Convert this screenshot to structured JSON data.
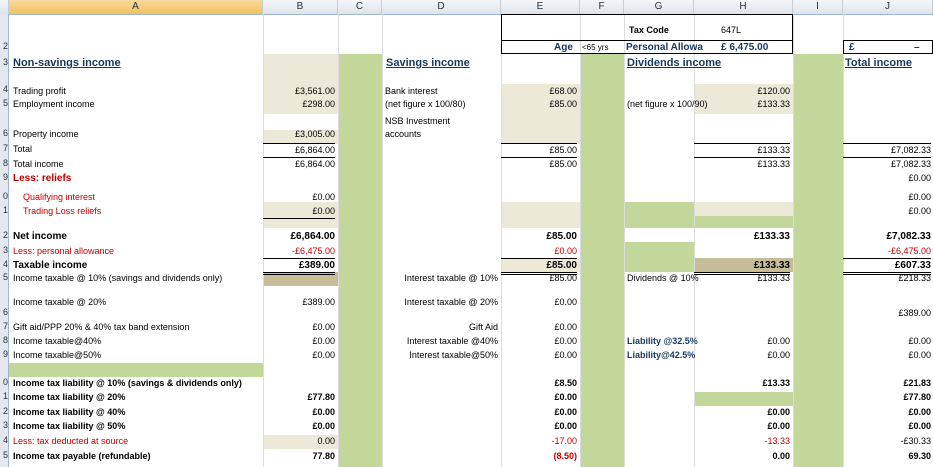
{
  "columns": [
    "A",
    "B",
    "C",
    "D",
    "E",
    "F",
    "G",
    "H",
    "I",
    "J"
  ],
  "row_numbers": [
    "",
    "2",
    "3",
    "4",
    "5",
    "",
    "6",
    "7",
    "8",
    "9",
    "0",
    "1",
    "",
    "2",
    "3",
    "4",
    "5",
    "",
    "6",
    "7",
    "8",
    "9",
    "",
    "0",
    "1",
    "2",
    "3",
    "4",
    "5"
  ],
  "header": {
    "tax_code_label": "Tax Code",
    "tax_code_value": "647L",
    "age_label": "Age",
    "age_value": "<65 yrs",
    "personal_allowance_label": "Personal Allowa",
    "personal_allowance_value": "£ 6,475.00",
    "j_currency": "£",
    "j_dash": "–"
  },
  "sections": {
    "non_savings": "Non-savings income",
    "savings": "Savings income",
    "dividends": "Dividends income",
    "total": "Total income"
  },
  "labels": {
    "trading_profit": "Trading profit",
    "employment_income": "Employment income",
    "bank_interest": "Bank interest",
    "net_figure_80": "(net figure x 100/80)",
    "net_figure_90": "(net figure x 100/90)",
    "nsb_1": "NSB Investment",
    "nsb_2": "accounts",
    "property_income": "Property income",
    "total": "Total",
    "total_income": "Total income",
    "less_reliefs": "Less: reliefs",
    "qualifying_interest": "Qualifying interest",
    "trading_loss": "Trading Loss reliefs",
    "net_income": "Net income",
    "less_pa": "Less: personal allowance",
    "taxable_income": "Taxable income",
    "income_taxable_10": "Income taxable @ 10% (savings and dividends only)",
    "interest_taxable_10": "Interest taxable @ 10%",
    "dividends_10": "Dividends @ 10%",
    "income_taxable_20": "Income taxable @ 20%",
    "interest_taxable_20": "Interest taxable @ 20%",
    "gift_aid_ext": "Gift aid/PPP 20% & 40% tax band extension",
    "gift_aid": "Gift Aid",
    "income_taxable_40": "Income taxable@40%",
    "interest_taxable_40": "Interest taxable @40%",
    "liability_325": "Liability @32.5%",
    "income_taxable_50": "Income taxable@50%",
    "interest_taxable_50": "Interest taxable@50%",
    "liability_425": "Liability@42.5%",
    "liab_10": "Income tax liability @ 10% (savings & dividends only)",
    "liab_20": "Income tax liability @ 20%",
    "liab_40": "Income tax liability @ 40%",
    "liab_50": "Income tax liability @ 50%",
    "less_tax_source": "Less: tax deducted at source",
    "tax_payable": "Income tax payable (refundable)"
  },
  "col_b": {
    "trading_profit": "£3,561.00",
    "employment_income": "£298.00",
    "property_income": "£3,005.00",
    "total": "£6,864.00",
    "total_income": "£6,864.00",
    "qualifying_interest": "£0.00",
    "trading_loss": "£0.00",
    "net_income": "£6,864.00",
    "less_pa": "-£6,475.00",
    "taxable_income": "£389.00",
    "income_taxable_20": "£389.00",
    "gift_aid_ext": "£0.00",
    "income_taxable_40": "£0.00",
    "income_taxable_50": "£0.00",
    "liab_20": "£77.80",
    "liab_40": "£0.00",
    "liab_50": "£0.00",
    "less_tax_source": "0.00",
    "tax_payable": "77.80"
  },
  "col_e": {
    "bank_interest": "£68.00",
    "net_figure_80": "£85.00",
    "total": "£85.00",
    "total_income": "£85.00",
    "net_income": "£85.00",
    "less_pa": "£0.00",
    "taxable_income": "£85.00",
    "interest_taxable_10": "£85.00",
    "interest_taxable_20": "£0.00",
    "gift_aid": "£0.00",
    "interest_taxable_40": "£0.00",
    "interest_taxable_50": "£0.00",
    "liab_10": "£8.50",
    "liab_20": "£0.00",
    "liab_40": "£0.00",
    "liab_50": "£0.00",
    "less_tax_source": "-17.00",
    "tax_payable": "(8.50)"
  },
  "col_h": {
    "dividends": "£120.00",
    "net_figure_90": "£133.33",
    "total": "£133.33",
    "total_income": "£133.33",
    "net_income": "£133.33",
    "taxable_income": "£133.33",
    "dividends_10": "£133.33",
    "liability_325": "£0.00",
    "liability_425": "£0.00",
    "liab_10": "£13.33",
    "liab_40": "£0.00",
    "liab_50": "£0.00",
    "less_tax_source": "-13.33",
    "tax_payable": "0.00"
  },
  "col_j": {
    "total": "£7,082.33",
    "total_income": "£7,082.33",
    "less_reliefs": "£0.00",
    "qualifying_interest": "£0.00",
    "trading_loss": "£0.00",
    "net_income": "£7,082.33",
    "less_pa": "-£6,475.00",
    "taxable_income": "£607.33",
    "income_taxable_10": "£218.33",
    "income_taxable_20": "£389.00",
    "gift_aid_ext": "£0.00",
    "income_taxable_40": "£0.00",
    "income_taxable_50": "£0.00",
    "liab_10": "£21.83",
    "liab_20": "£77.80",
    "liab_40": "£0.00",
    "liab_50": "£0.00",
    "less_tax_source": "-£30.33",
    "tax_payable": "69.30"
  },
  "colors": {
    "green_band": "#c4d79b",
    "input_fill": "#ece9d8",
    "olive_fill": "#c4bd97",
    "red_text": "#c00000",
    "navy_text": "#17375e",
    "header_selected": "#f1c15f"
  }
}
